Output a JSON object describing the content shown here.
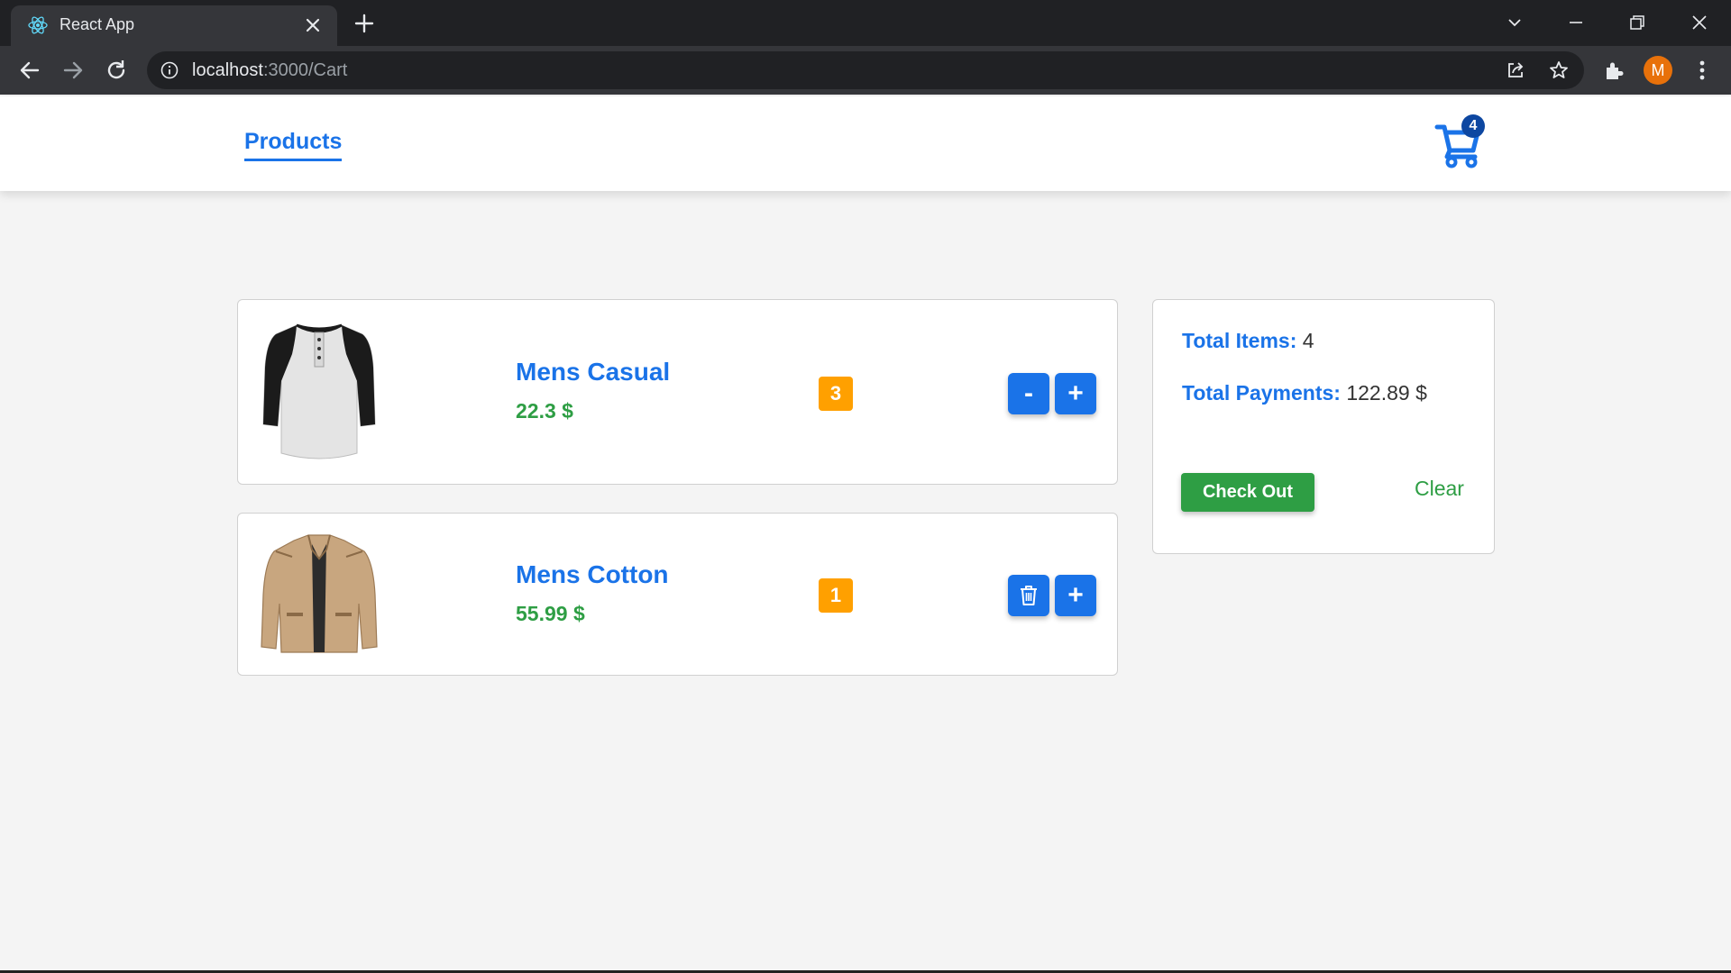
{
  "browser": {
    "tab_title": "React App",
    "url_host": "localhost",
    "url_path": ":3000/Cart",
    "profile_initial": "M"
  },
  "navbar": {
    "products_link": "Products",
    "cart_count": "4"
  },
  "cart_items": [
    {
      "name": "Mens Casual",
      "price": "22.3 $",
      "quantity": "3",
      "decrement_label": "-",
      "increment_label": "+",
      "image": "raglan-henley-shirt"
    },
    {
      "name": "Mens Cotton",
      "price": "55.99 $",
      "quantity": "1",
      "decrement_icon": "trash-icon",
      "increment_label": "+",
      "image": "khaki-cotton-jacket"
    }
  ],
  "summary": {
    "total_items_label": "Total Items:",
    "total_items_value": "4",
    "total_payments_label": "Total Payments:",
    "total_payments_value": "122.89 $",
    "checkout_label": "Check Out",
    "clear_label": "Clear"
  },
  "colors": {
    "accent_blue": "#1a73e8",
    "price_green": "#2e9e44",
    "qty_orange": "#ffa000",
    "badge_navy": "#0d47a1"
  }
}
